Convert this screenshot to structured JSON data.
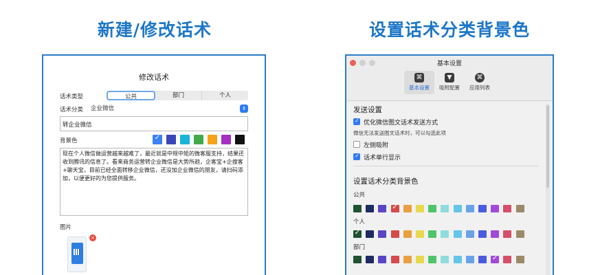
{
  "headings": {
    "left": "新建/修改话术",
    "right": "设置话术分类背景色"
  },
  "left_dialog": {
    "title": "修改话术",
    "type_label": "话术类型",
    "type_options": [
      "公共",
      "部门",
      "个人"
    ],
    "category_label": "话术分类",
    "category_value": "企业微信",
    "input_value": "转企业微信",
    "bg_label": "背景色",
    "bg_colors": [
      "#3b82f6",
      "#3b46b8",
      "#19b4d6",
      "#44a84c",
      "#f7a21b",
      "#a62ec0",
      "#111111"
    ],
    "bg_selected_index": 0,
    "body_text": "现在个人微信做运营越来越难了，最近就是中规中矩的微客服支持，结果还收到腾讯的信息了。看来商务运营转企业微信是大势所趋，企客宝+企搜客+聊天宝，目前已经全面转移企业微信，还没加企业微信的朋友，请扫码添加，以便更好的为您提供服务。",
    "image_label": "图片",
    "delete_icon": "×"
  },
  "right_window": {
    "title": "基本设置",
    "toolbar": [
      {
        "label": "基本设置",
        "icon": "⌘",
        "color": "#3b3b3b"
      },
      {
        "label": "吸附配置",
        "icon": "▼",
        "color": "#3b3b3b"
      },
      {
        "label": "应用列表",
        "icon": "⌘",
        "color": "#3b3b3b"
      }
    ],
    "send_title": "发送设置",
    "opt_optimize": "优化微信图文话术发送方式",
    "hint": "微信无法发送图文话术时，可以勾选此项",
    "opt_left_dock": "左侧吸附",
    "opt_single_line": "话术单行显示",
    "bg_title": "设置话术分类背景色",
    "groups": [
      {
        "label": "公共",
        "checked": 3
      },
      {
        "label": "个人",
        "checked": 0
      },
      {
        "label": "部门",
        "checked": 11
      }
    ],
    "palette": [
      "#1f5133",
      "#1d2b63",
      "#5a45c6",
      "#d74a4a",
      "#e8a040",
      "#e8d94c",
      "#4fc46a",
      "#8fdcdc",
      "#63c6e8",
      "#6aa2e8",
      "#4a5cde",
      "#a24ad8",
      "#d4506a",
      "#9b8a6a"
    ]
  }
}
